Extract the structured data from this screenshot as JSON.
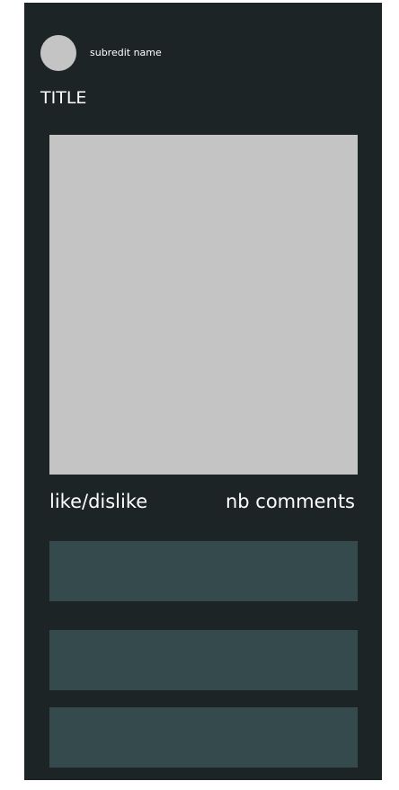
{
  "post": {
    "subreddit_name": "subredit name",
    "title": "TITLE",
    "like_dislike_label": "like/dislike",
    "comments_count_label": "nb comments"
  },
  "colors": {
    "background": "#1c2426",
    "placeholder": "#c4c4c4",
    "comment_box": "#344a4c",
    "text": "#ffffff"
  }
}
